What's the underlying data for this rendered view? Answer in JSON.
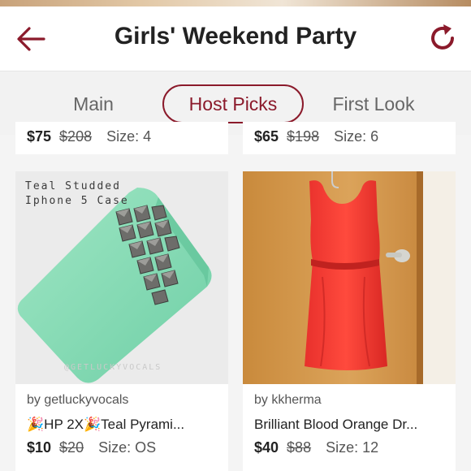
{
  "header": {
    "title": "Girls' Weekend Party",
    "back_icon": "back-arrow-icon",
    "refresh_icon": "refresh-icon",
    "accent_color": "#8b1a2b"
  },
  "tabs": [
    {
      "label": "Main",
      "active": false
    },
    {
      "label": "Host Picks",
      "active": true
    },
    {
      "label": "First Look",
      "active": false
    }
  ],
  "listings": [
    {
      "price": "$75",
      "original": "$208",
      "size": "Size: 4"
    },
    {
      "price": "$65",
      "original": "$198",
      "size": "Size: 6"
    },
    {
      "seller": "by getluckyvocals",
      "title": "🎉HP 2X🎉Teal Pyrami...",
      "price": "$10",
      "original": "$20",
      "size": "Size: OS",
      "photo_caption": [
        "Teal Studded",
        "Iphone 5 Case"
      ],
      "watermark": "@GETLUCKYVOCALS"
    },
    {
      "seller": "by kkherma",
      "title": "Brilliant Blood Orange Dr...",
      "price": "$40",
      "original": "$88",
      "size": "Size: 12"
    }
  ]
}
